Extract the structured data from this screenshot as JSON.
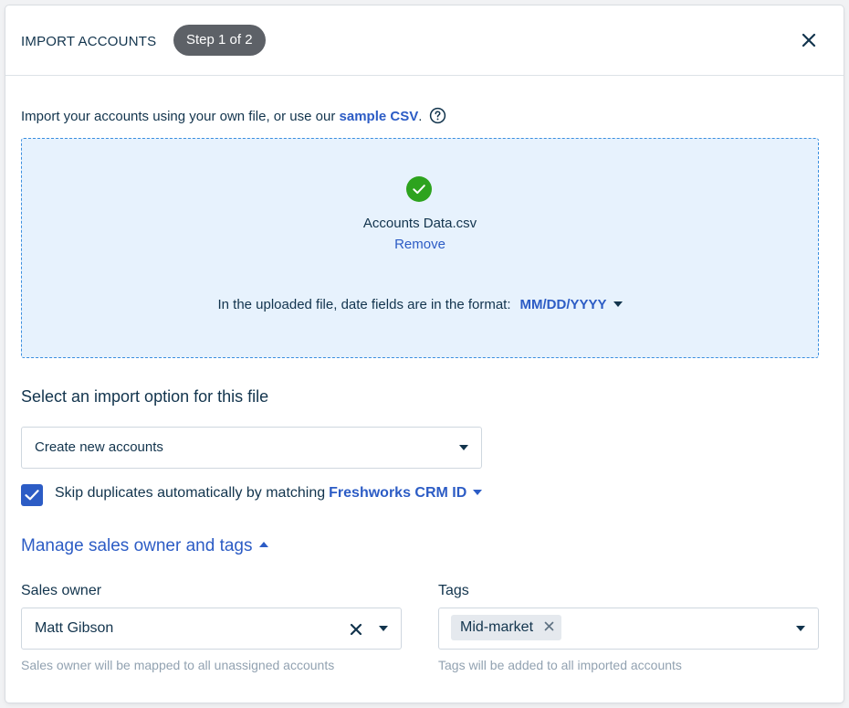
{
  "header": {
    "title": "IMPORT ACCOUNTS",
    "step": "Step 1 of 2"
  },
  "intro": {
    "text": "Import your accounts using your own file, or use our ",
    "link": "sample CSV",
    "suffix": "."
  },
  "upload": {
    "file_name": "Accounts Data.csv",
    "remove_label": "Remove",
    "date_prefix": "In the uploaded file, date fields are in the format:",
    "date_format": "MM/DD/YYYY"
  },
  "import_option": {
    "title": "Select an import option for this file",
    "selected": "Create new accounts"
  },
  "duplicates": {
    "checked": true,
    "text": "Skip duplicates automatically by matching",
    "field": "Freshworks CRM ID"
  },
  "manage": {
    "label": "Manage sales owner and tags"
  },
  "sales_owner": {
    "label": "Sales owner",
    "value": "Matt Gibson",
    "hint": "Sales owner will be mapped to all unassigned accounts"
  },
  "tags": {
    "label": "Tags",
    "chips": [
      "Mid-market"
    ],
    "hint": "Tags will be added to all imported accounts"
  },
  "colors": {
    "accent": "#2c5cc5",
    "success": "#2da31e",
    "dropzone_bg": "#e7f2fd",
    "dropzone_border": "#3b8fe0",
    "step_pill": "#5d6167"
  },
  "icons": {
    "close": "close-icon",
    "help": "help-circle-icon",
    "success": "check-circle-icon",
    "caret": "caret-down-icon",
    "caret_up": "caret-up-icon",
    "checkbox": "checkmark-icon",
    "clear": "clear-x-icon"
  }
}
